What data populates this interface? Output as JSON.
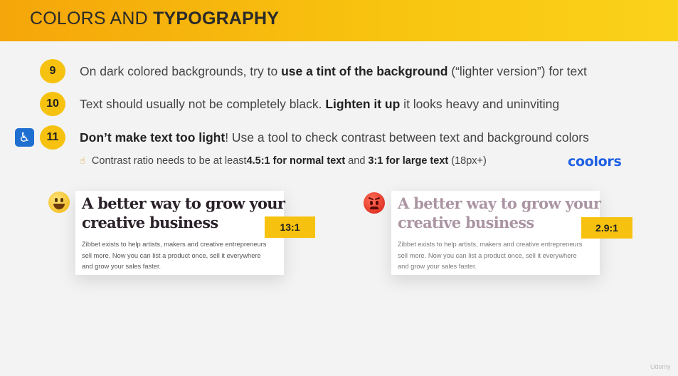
{
  "header": {
    "title_regular": "COLORS AND ",
    "title_bold": "TYPOGRAPHY"
  },
  "rules": [
    {
      "number": "9",
      "before": "On dark colored backgrounds, try to ",
      "bold": "use a tint of the background",
      "after": " (“lighter version”) for text"
    },
    {
      "number": "10",
      "before": "Text should usually not be completely black. ",
      "bold": "Lighten it up",
      "after": " it looks heavy and uninviting"
    },
    {
      "number": "11",
      "bold": "Don’t make text too light",
      "after": "! Use a tool to check contrast between text and background colors"
    }
  ],
  "sub_note": {
    "before": "Contrast ratio needs to be at least ",
    "bold1": "4.5:1 for normal text",
    "mid": " and ",
    "bold2": "3:1 for large text",
    "after": " (18px+)"
  },
  "brand": {
    "coolors_logo": "coolors"
  },
  "icons": {
    "accessibility": "wheelchair-icon",
    "hint": "pointing-hand-icon",
    "good": "smiley-icon",
    "bad": "angry-face-icon"
  },
  "examples": [
    {
      "title_line1": "A better way to grow your",
      "title_line2": "creative business",
      "body_lines": [
        "Zibbet exists to help artists, makers and creative entrepreneurs",
        "sell more. Now you can list a product once, sell it everywhere",
        "and grow your sales faster."
      ],
      "ratio": "13:1"
    },
    {
      "title_line1": "A better way to grow your",
      "title_line2": "creative business",
      "body_lines": [
        "Zibbet exists to help artists, makers and creative entrepreneurs",
        "sell more. Now you can list a product once, sell it everywhere",
        "and grow your sales faster."
      ],
      "ratio": "2.9:1"
    }
  ],
  "colors": {
    "accent_yellow": "#f6c20f",
    "header_gradient_start": "#f5a60a",
    "coolors_blue": "#1d5fe3",
    "dark_text": "#2b2129",
    "light_text": "#ab95a3"
  },
  "watermark": "Udemy"
}
